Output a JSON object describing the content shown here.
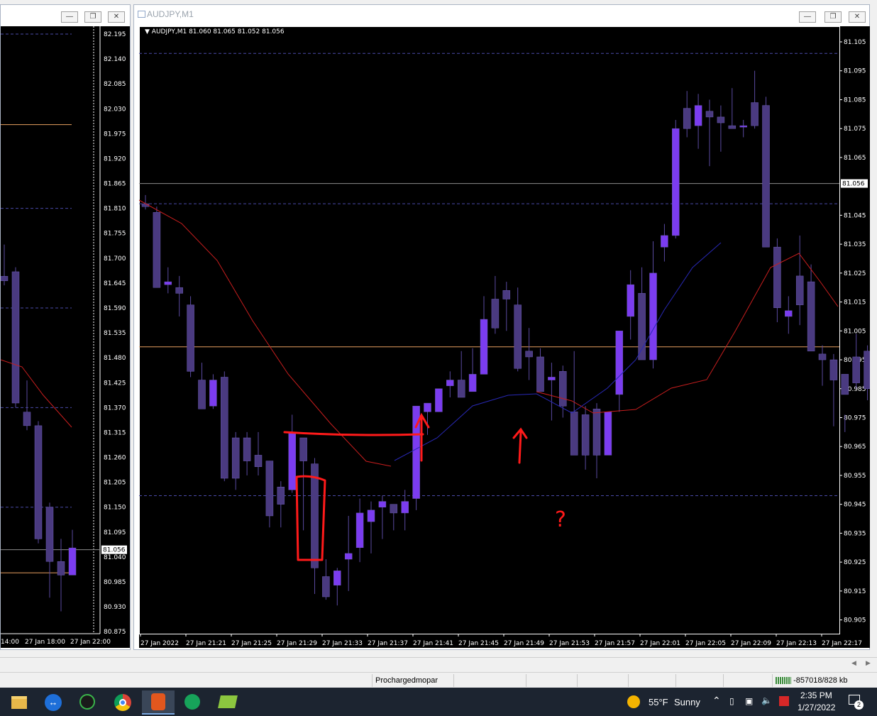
{
  "left_window": {
    "price_labels": [
      "82.195",
      "82.140",
      "82.085",
      "82.030",
      "81.975",
      "81.920",
      "81.865",
      "81.810",
      "81.755",
      "81.700",
      "81.645",
      "81.590",
      "81.535",
      "81.480",
      "81.425",
      "81.370",
      "81.315",
      "81.260",
      "81.205",
      "81.150",
      "81.095",
      "81.040",
      "80.985",
      "80.930",
      "80.875"
    ],
    "current_price": "81.056",
    "time_labels": [
      "14:00",
      "27 Jan 18:00",
      "27 Jan 22:00"
    ]
  },
  "main_window": {
    "title": "AUDJPY,M1",
    "chart_header": "AUDJPY,M1  81.060 81.065 81.052 81.056",
    "price_labels": [
      "81.105",
      "81.095",
      "81.085",
      "81.075",
      "81.065",
      "81.056",
      "81.045",
      "81.035",
      "81.025",
      "81.015",
      "81.005",
      "80.995",
      "80.985",
      "80.975",
      "80.965",
      "80.955",
      "80.945",
      "80.935",
      "80.925",
      "80.915",
      "80.905"
    ],
    "current_price": "81.056",
    "time_labels": [
      "27 Jan 2022",
      "27 Jan 21:21",
      "27 Jan 21:25",
      "27 Jan 21:29",
      "27 Jan 21:33",
      "27 Jan 21:37",
      "27 Jan 21:41",
      "27 Jan 21:45",
      "27 Jan 21:49",
      "27 Jan 21:53",
      "27 Jan 21:57",
      "27 Jan 22:01",
      "27 Jan 22:05",
      "27 Jan 22:09",
      "27 Jan 22:13",
      "27 Jan 22:17"
    ],
    "annotation_mark": "?"
  },
  "status_bar": {
    "profile": "Prochargedmopar",
    "traffic": "-857018/828 kb"
  },
  "taskbar": {
    "weather_temp": "55°F",
    "weather_desc": "Sunny",
    "time": "2:35 PM",
    "date": "1/27/2022",
    "notification_count": "2"
  },
  "colors": {
    "bull_candle": "#7b3cf0",
    "bear_candle": "#4a3a80",
    "ma_fast": "#c81e1e",
    "ma_slow": "#2828b4",
    "level_line": "#e8a060",
    "dash_line": "#4a4aa8",
    "annotation": "#ff1a1a"
  }
}
